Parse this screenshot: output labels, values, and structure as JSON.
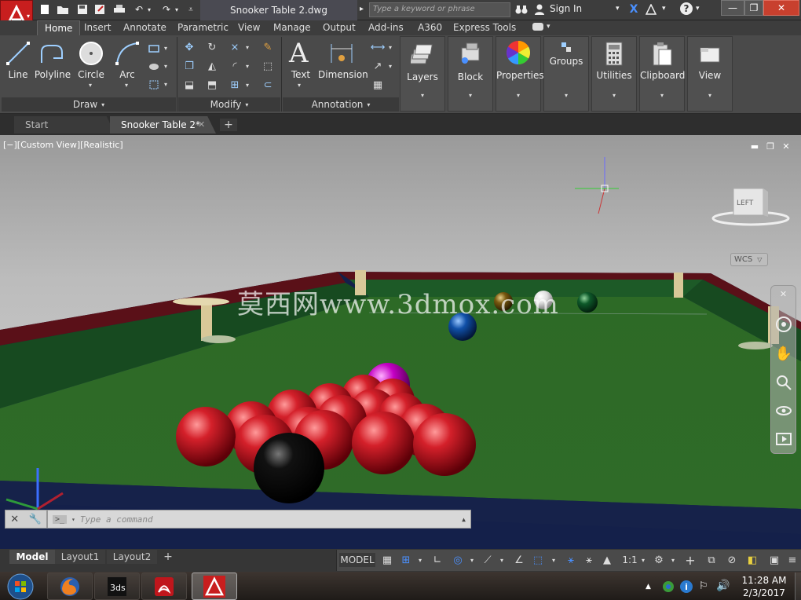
{
  "title_bar": {
    "document_title": "Snooker Table 2.dwg",
    "search_placeholder": "Type a keyword or phrase",
    "sign_in": "Sign In"
  },
  "ribbon_tabs": [
    "Home",
    "Insert",
    "Annotate",
    "Parametric",
    "View",
    "Manage",
    "Output",
    "Add-ins",
    "A360",
    "Express Tools"
  ],
  "active_tab": "Home",
  "ribbon": {
    "draw": {
      "panel_label": "Draw",
      "tools": [
        "Line",
        "Polyline",
        "Circle",
        "Arc"
      ]
    },
    "modify": {
      "panel_label": "Modify"
    },
    "annotation": {
      "panel_label": "Annotation",
      "tools": [
        "Text",
        "Dimension"
      ]
    },
    "big_panels": [
      "Layers",
      "Block",
      "Properties",
      "Groups",
      "Utilities",
      "Clipboard",
      "View"
    ]
  },
  "file_tabs": {
    "start": "Start",
    "current": "Snooker Table 2*"
  },
  "viewport": {
    "label": "[−][Custom View][Realistic]",
    "viewcube_face": "LEFT",
    "wcs": "WCS",
    "watermark": "莫西网www.3dmox.com"
  },
  "command_line": {
    "placeholder": "Type a command"
  },
  "layout_tabs": [
    "Model",
    "Layout1",
    "Layout2"
  ],
  "status_bar": {
    "mode": "MODEL",
    "scale": "1:1"
  },
  "taskbar": {
    "time": "11:28 AM",
    "date": "2/3/2017"
  },
  "colors": {
    "autocad_red": "#c81e1e",
    "table_green": "#2f6b28",
    "ribbon_bg": "#4a4a4a"
  }
}
